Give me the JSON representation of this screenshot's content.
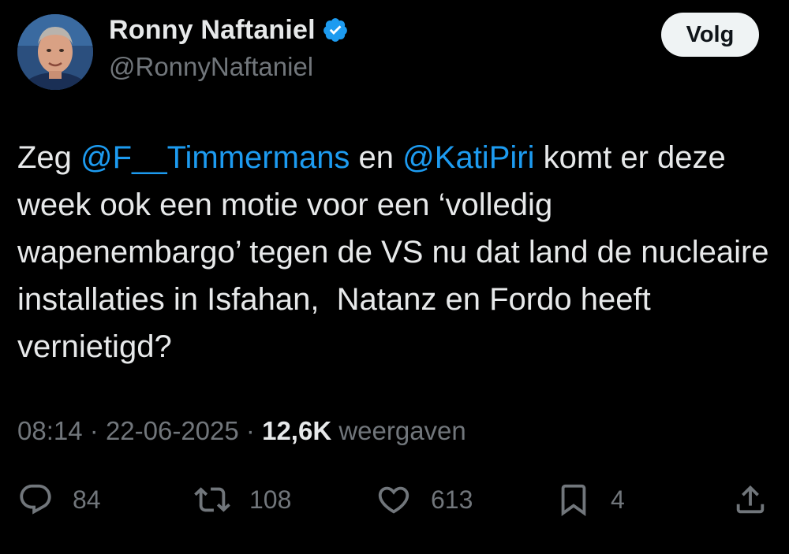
{
  "author": {
    "display_name": "Ronny Naftaniel",
    "handle": "@RonnyNaftaniel",
    "verified": true,
    "verified_color": "#1d9bf0"
  },
  "follow_button": {
    "label": "Volg"
  },
  "tweet": {
    "segments": [
      {
        "text": "Zeg ",
        "type": "text"
      },
      {
        "text": "@F__Timmermans",
        "type": "mention"
      },
      {
        "text": " en ",
        "type": "text"
      },
      {
        "text": "@KatiPiri",
        "type": "mention"
      },
      {
        "text": " komt er deze week ook een motie voor een ‘volledig wapenembargo’ tegen de VS nu dat land de nucleaire installaties in Isfahan,  Natanz en Fordo heeft vernietigd?",
        "type": "text"
      }
    ]
  },
  "meta": {
    "time": "08:14",
    "separator": "·",
    "date": "22-06-2025",
    "views_count": "12,6K",
    "views_label": "weergaven"
  },
  "actions": {
    "replies": {
      "icon": "reply-icon",
      "count": "84"
    },
    "reposts": {
      "icon": "repost-icon",
      "count": "108"
    },
    "likes": {
      "icon": "heart-icon",
      "count": "613"
    },
    "bookmarks": {
      "icon": "bookmark-icon",
      "count": "4"
    },
    "share": {
      "icon": "share-icon"
    }
  },
  "colors": {
    "background": "#000000",
    "primary_text": "#e7e9ea",
    "secondary_text": "#71767b",
    "accent": "#1d9bf0",
    "button_bg": "#eff3f4"
  }
}
